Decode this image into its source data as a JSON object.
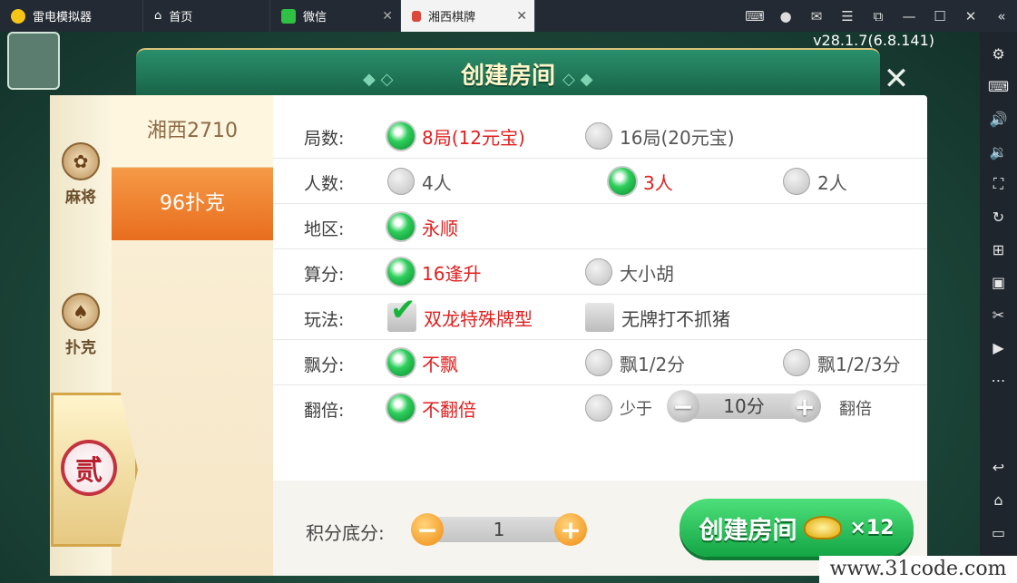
{
  "emulator": {
    "tabs": [
      {
        "label": "雷电模拟器",
        "icon": "leidian-logo-icon"
      },
      {
        "label": "首页",
        "icon": "home-icon"
      },
      {
        "label": "微信",
        "icon": "wechat-icon"
      },
      {
        "label": "湘西棋牌",
        "icon": "game-app-icon"
      }
    ],
    "tab_close": "✕",
    "window_icons": [
      "gamepad-icon",
      "user-icon",
      "mail-icon",
      "menu-icon",
      "restore-icon",
      "minimize-icon",
      "maximize-icon",
      "close-icon",
      "collapse-icon"
    ],
    "sidebar_icons": [
      "settings-icon",
      "keyboard-icon",
      "volume-up-icon",
      "volume-down-icon",
      "screenshot-icon",
      "rotate-icon",
      "add-window-icon",
      "apk-icon",
      "scissors-icon",
      "record-icon",
      "more-icon",
      "back-icon",
      "home-nav-icon",
      "recent-icon"
    ]
  },
  "game": {
    "version": "v28.1.7(6.8.141)",
    "dialog_title": "创建房间",
    "close_symbol": "✕",
    "categories": [
      {
        "label": "麻将",
        "icon": "mahjong-icon"
      },
      {
        "label": "扑克",
        "icon": "spade-icon"
      }
    ],
    "badge_char": "贰",
    "game_list": [
      {
        "label": "湘西2710",
        "active": false
      },
      {
        "label": "96扑克",
        "active": true
      }
    ],
    "rows": [
      {
        "label": "局数:",
        "options": [
          {
            "text": "8局(12元宝)",
            "selected": true
          },
          {
            "text": "16局(20元宝)",
            "selected": false
          }
        ]
      },
      {
        "label": "人数:",
        "options": [
          {
            "text": "4人",
            "selected": false
          },
          {
            "text": "3人",
            "selected": true
          },
          {
            "text": "2人",
            "selected": false
          }
        ]
      },
      {
        "label": "地区:",
        "options": [
          {
            "text": "永顺",
            "selected": true
          }
        ]
      },
      {
        "label": "算分:",
        "options": [
          {
            "text": "16逢升",
            "selected": true
          },
          {
            "text": "大小胡",
            "selected": false
          }
        ]
      },
      {
        "label": "玩法:",
        "checkboxes": [
          {
            "text": "双龙特殊牌型",
            "checked": true
          },
          {
            "text": "无牌打不抓猪",
            "checked": false
          }
        ]
      },
      {
        "label": "飘分:",
        "options": [
          {
            "text": "不飘",
            "selected": true
          },
          {
            "text": "飘1/2分",
            "selected": false
          },
          {
            "text": "飘1/2/3分",
            "selected": false
          }
        ]
      },
      {
        "label": "翻倍:",
        "options": [
          {
            "text": "不翻倍",
            "selected": true
          },
          {
            "text": "少于",
            "selected": false
          }
        ],
        "stepper_value": "10分",
        "suffix": "翻倍"
      }
    ],
    "score_label": "积分底分:",
    "score_value": "1",
    "minus": "−",
    "plus": "+",
    "create_button": "创建房间",
    "cost": "×12",
    "watermark": "www.31code.com"
  }
}
